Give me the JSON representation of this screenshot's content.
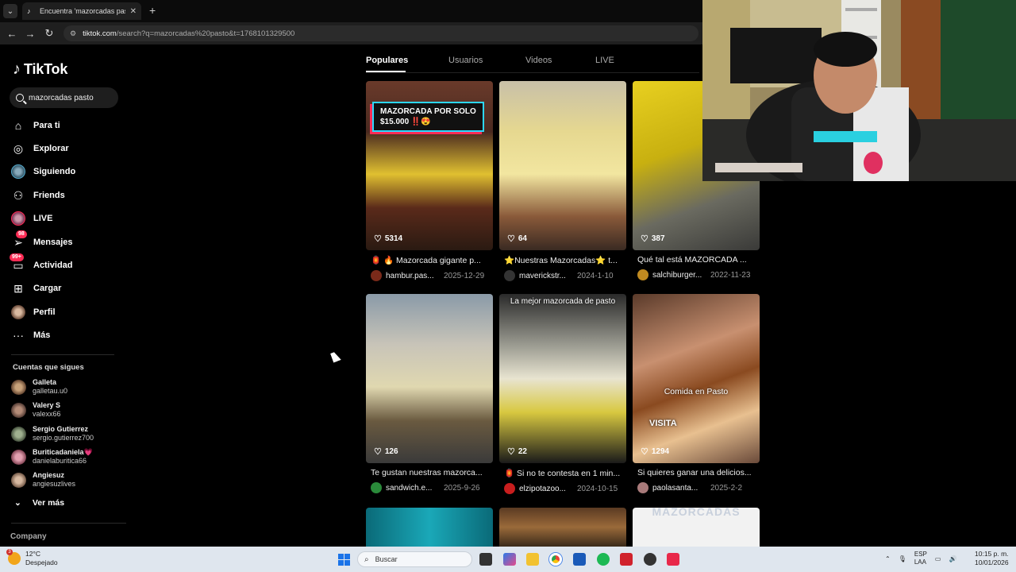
{
  "browser": {
    "tab_title": "Encuentra 'mazorcadas pasto' e",
    "tab_close": "✕",
    "new_tab": "+",
    "url_domain": "tiktok.com",
    "url_path": "/search?q=mazorcadas%20pasto&t=1768101329500"
  },
  "sidebar": {
    "brand": "TikTok",
    "search_value": "mazorcadas pasto",
    "nav": [
      {
        "label": "Para ti"
      },
      {
        "label": "Explorar"
      },
      {
        "label": "Siguiendo"
      },
      {
        "label": "Friends"
      },
      {
        "label": "LIVE"
      },
      {
        "label": "Mensajes",
        "badge": "98"
      },
      {
        "label": "Actividad",
        "badge": "99+"
      },
      {
        "label": "Cargar"
      },
      {
        "label": "Perfil"
      },
      {
        "label": "Más"
      }
    ],
    "following_header": "Cuentas que sigues",
    "accounts": [
      {
        "name": "Galleta",
        "handle": "galletau.u0"
      },
      {
        "name": "Valery S",
        "handle": "valexx66"
      },
      {
        "name": "Sergio Gutierrez",
        "handle": "sergio.gutierrez700"
      },
      {
        "name": "Buriticadaniela💗",
        "handle": "danielaburitica66"
      },
      {
        "name": "Angiesuz",
        "handle": "angiesuzlives"
      }
    ],
    "see_more": "Ver más",
    "company": "Company"
  },
  "search_tabs": [
    "Populares",
    "Usuarios",
    "Videos",
    "LIVE"
  ],
  "results": [
    {
      "likes": "5314",
      "title": "🏮 🔥 Mazorcada gigante p...",
      "user": "hambur.pas...",
      "date": "2025-12-29",
      "overlay": "MAZORCADA POR SOLO\n$15.000 ‼️😍"
    },
    {
      "likes": "64",
      "title": "⭐Nuestras Mazorcadas⭐ t...",
      "user": "maverickstr...",
      "date": "2024-1-10",
      "overlay": ""
    },
    {
      "likes": "387",
      "title": "Qué tal está MAZORCADA ...",
      "user": "salchiburger...",
      "date": "2022-11-23",
      "overlay": ""
    },
    {
      "likes": "126",
      "title": "Te gustan nuestras mazorca...",
      "user": "sandwich.e...",
      "date": "2025-9-26",
      "overlay": ""
    },
    {
      "likes": "22",
      "title": "🏮 Si no te contesta en 1 min...",
      "user": "elzipotazoo...",
      "date": "2024-10-15",
      "overlay": "La mejor mazorcada de pasto"
    },
    {
      "likes": "1294",
      "title": "Si quieres ganar una delicios...",
      "user": "paolasanta...",
      "date": "2025-2-2",
      "overlay": "Comida en Pasto",
      "overlay2": "VISITA"
    }
  ],
  "third_row_caption": "MAZORCADAS",
  "taskbar": {
    "temp": "12°C",
    "weather": "Despejado",
    "weather_alert": "3",
    "search_placeholder": "Buscar",
    "lang1": "ESP",
    "lang2": "LAA",
    "time": "10:15 p. m.",
    "date": "10/01/2026"
  }
}
